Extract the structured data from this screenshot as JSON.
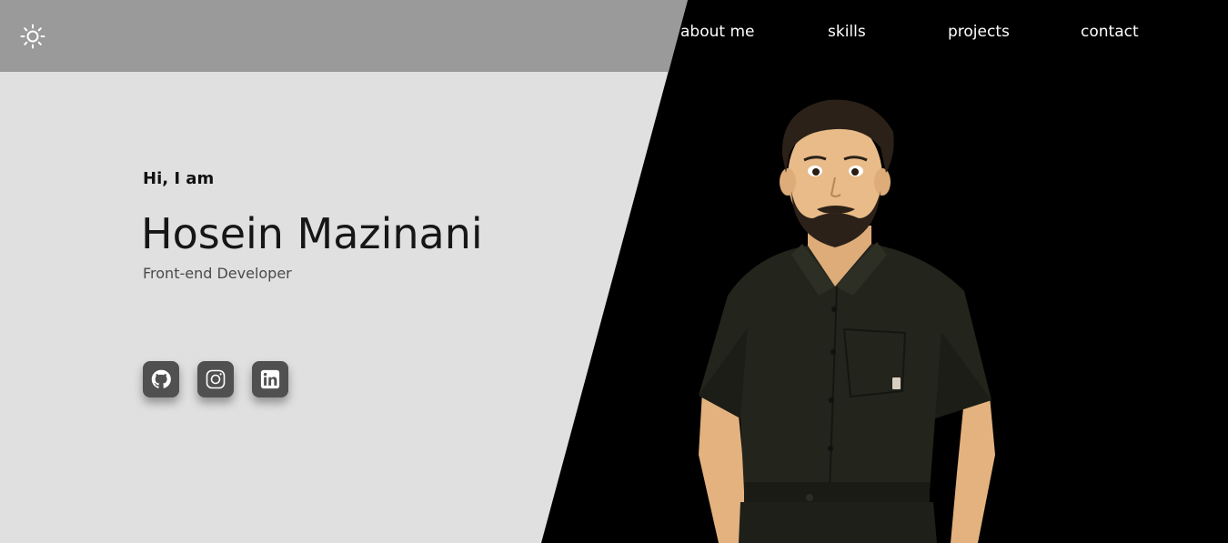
{
  "header": {
    "theme_toggle_icon": "sun-icon",
    "nav": [
      {
        "label": "about me"
      },
      {
        "label": "skills"
      },
      {
        "label": "projects"
      },
      {
        "label": "contact"
      }
    ]
  },
  "hero": {
    "greeting": "Hi, I am",
    "name": "Hosein Mazinani",
    "role": "Front-end Developer",
    "socials": [
      {
        "icon": "github-icon"
      },
      {
        "icon": "instagram-icon"
      },
      {
        "icon": "linkedin-icon"
      }
    ]
  },
  "colors": {
    "left_panel": "#e0e0e0",
    "header_band": "#9a9a9a",
    "right_panel": "#000000",
    "social_button": "#505050"
  }
}
